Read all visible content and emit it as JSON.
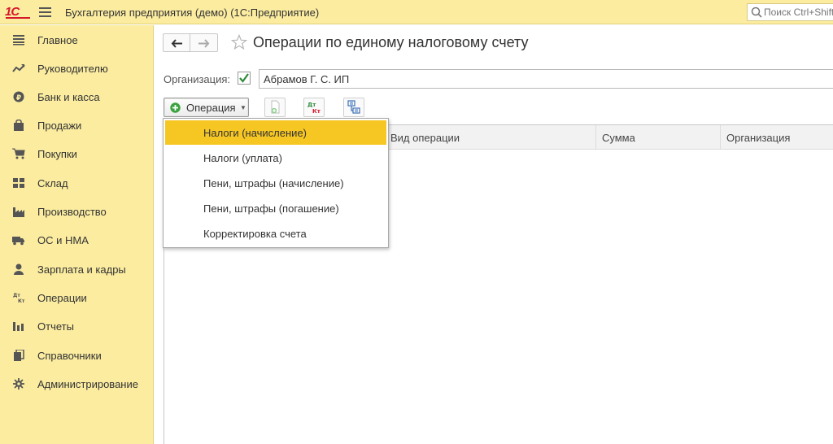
{
  "header": {
    "logo": "1С",
    "app_title": "Бухгалтерия предприятия (демо)  (1С:Предприятие)",
    "search_placeholder": "Поиск Ctrl+Shift+F"
  },
  "sidebar": {
    "items": [
      {
        "label": "Главное",
        "icon": "menu-lines-icon"
      },
      {
        "label": "Руководителю",
        "icon": "trend-icon"
      },
      {
        "label": "Банк и касса",
        "icon": "ruble-coin-icon"
      },
      {
        "label": "Продажи",
        "icon": "shopping-bag-icon"
      },
      {
        "label": "Покупки",
        "icon": "cart-icon"
      },
      {
        "label": "Склад",
        "icon": "warehouse-icon"
      },
      {
        "label": "Производство",
        "icon": "factory-icon"
      },
      {
        "label": "ОС и НМА",
        "icon": "truck-icon"
      },
      {
        "label": "Зарплата и кадры",
        "icon": "person-icon"
      },
      {
        "label": "Операции",
        "icon": "debit-credit-icon"
      },
      {
        "label": "Отчеты",
        "icon": "bar-chart-icon"
      },
      {
        "label": "Справочники",
        "icon": "books-icon"
      },
      {
        "label": "Администрирование",
        "icon": "gear-icon"
      }
    ]
  },
  "page": {
    "title": "Операции по единому налоговому счету",
    "organization_label": "Организация:",
    "organization_checked": true,
    "organization_value": "Абрамов Г. С. ИП"
  },
  "toolbar": {
    "operation_label": "Операция",
    "dtkt_label": "Дт Кт"
  },
  "grid": {
    "columns": [
      "",
      "Вид операции",
      "Сумма",
      "Организация"
    ]
  },
  "dropdown": {
    "items": [
      "Налоги (начисление)",
      "Налоги (уплата)",
      "Пени, штрафы (начисление)",
      "Пени, штрафы (погашение)",
      "Корректировка счета"
    ],
    "active_index": 0
  },
  "colors": {
    "panel_bg": "#fbeca0",
    "highlight": "#f6c623",
    "brand_red": "#d6162b",
    "check_green": "#2e8b3a"
  }
}
